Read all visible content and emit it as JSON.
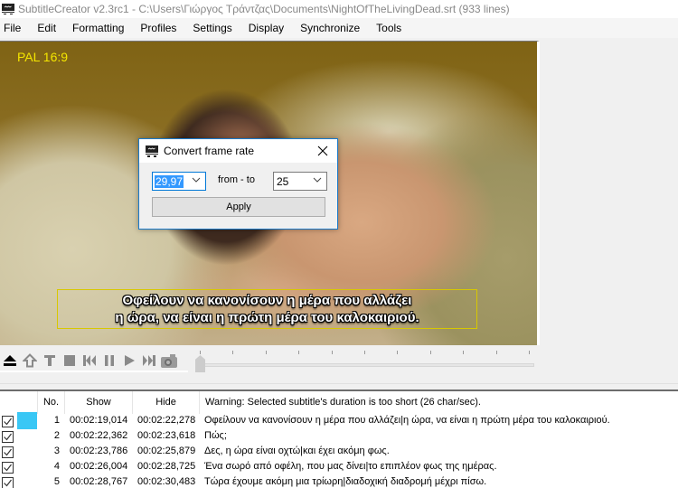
{
  "window": {
    "title": "SubtitleCreator v2.3rc1 - C:\\Users\\Γιώργος Τράντζας\\Documents\\NightOfTheLivingDead.srt (933 lines)"
  },
  "menu": [
    {
      "label": "File"
    },
    {
      "label": "Edit"
    },
    {
      "label": "Formatting"
    },
    {
      "label": "Profiles"
    },
    {
      "label": "Settings"
    },
    {
      "label": "Display"
    },
    {
      "label": "Synchronize"
    },
    {
      "label": "Tools"
    }
  ],
  "video": {
    "format_label": "PAL 16:9",
    "subtitle_lines": [
      "Οφείλουν να κανονίσουν η μέρα που αλλάζει",
      "η ώρα, να είναι η πρώτη μέρα του καλοκαιριού."
    ],
    "overlay_colors": {
      "format_label": "#f4e600",
      "subtitle_box_border": "#d8c800"
    }
  },
  "dialog": {
    "title": "Convert frame rate",
    "close_label": "✕",
    "from_value": "29,97",
    "separator_label": "from - to",
    "to_value": "25",
    "apply_label": "Apply"
  },
  "transport": {
    "buttons": [
      {
        "name": "eject",
        "icon": "eject-icon"
      },
      {
        "name": "home",
        "icon": "home-icon"
      },
      {
        "name": "text",
        "icon": "text-icon"
      },
      {
        "name": "stop",
        "icon": "stop-icon"
      },
      {
        "name": "previous",
        "icon": "skip-back-icon"
      },
      {
        "name": "pause",
        "icon": "pause-icon"
      },
      {
        "name": "play",
        "icon": "play-icon"
      },
      {
        "name": "next",
        "icon": "skip-forward-icon"
      },
      {
        "name": "snapshot",
        "icon": "camera-icon"
      }
    ],
    "position_fraction": 0.0,
    "tick_count": 11
  },
  "list": {
    "columns": {
      "no": "No.",
      "show": "Show",
      "hide": "Hide",
      "warning": "Warning: Selected subtitle's duration is too short (26 char/sec)."
    },
    "accent_color": "#39c7f5",
    "rows": [
      {
        "checked": true,
        "no": "1",
        "show": "00:02:19,014",
        "hide": "00:02:22,278",
        "text": "Οφείλουν να κανονίσουν η μέρα που αλλάζει|η ώρα, να είναι η πρώτη μέρα του καλοκαιριού.",
        "selected": true
      },
      {
        "checked": true,
        "no": "2",
        "show": "00:02:22,362",
        "hide": "00:02:23,618",
        "text": "Πώς;",
        "selected": false
      },
      {
        "checked": true,
        "no": "3",
        "show": "00:02:23,786",
        "hide": "00:02:25,879",
        "text": "Δες, η ώρα είναι οχτώ|και έχει ακόμη φως.",
        "selected": false
      },
      {
        "checked": true,
        "no": "4",
        "show": "00:02:26,004",
        "hide": "00:02:28,725",
        "text": "Ένα σωρό από οφέλη, που μας δίνει|το επιπλέον φως της ημέρας.",
        "selected": false
      },
      {
        "checked": true,
        "no": "5",
        "show": "00:02:28,767",
        "hide": "00:02:30,483",
        "text": "Τώρα έχουμε ακόμη μια τρίωρη|διαδοχική διαδρομή μέχρι πίσω.",
        "selected": false
      }
    ]
  }
}
